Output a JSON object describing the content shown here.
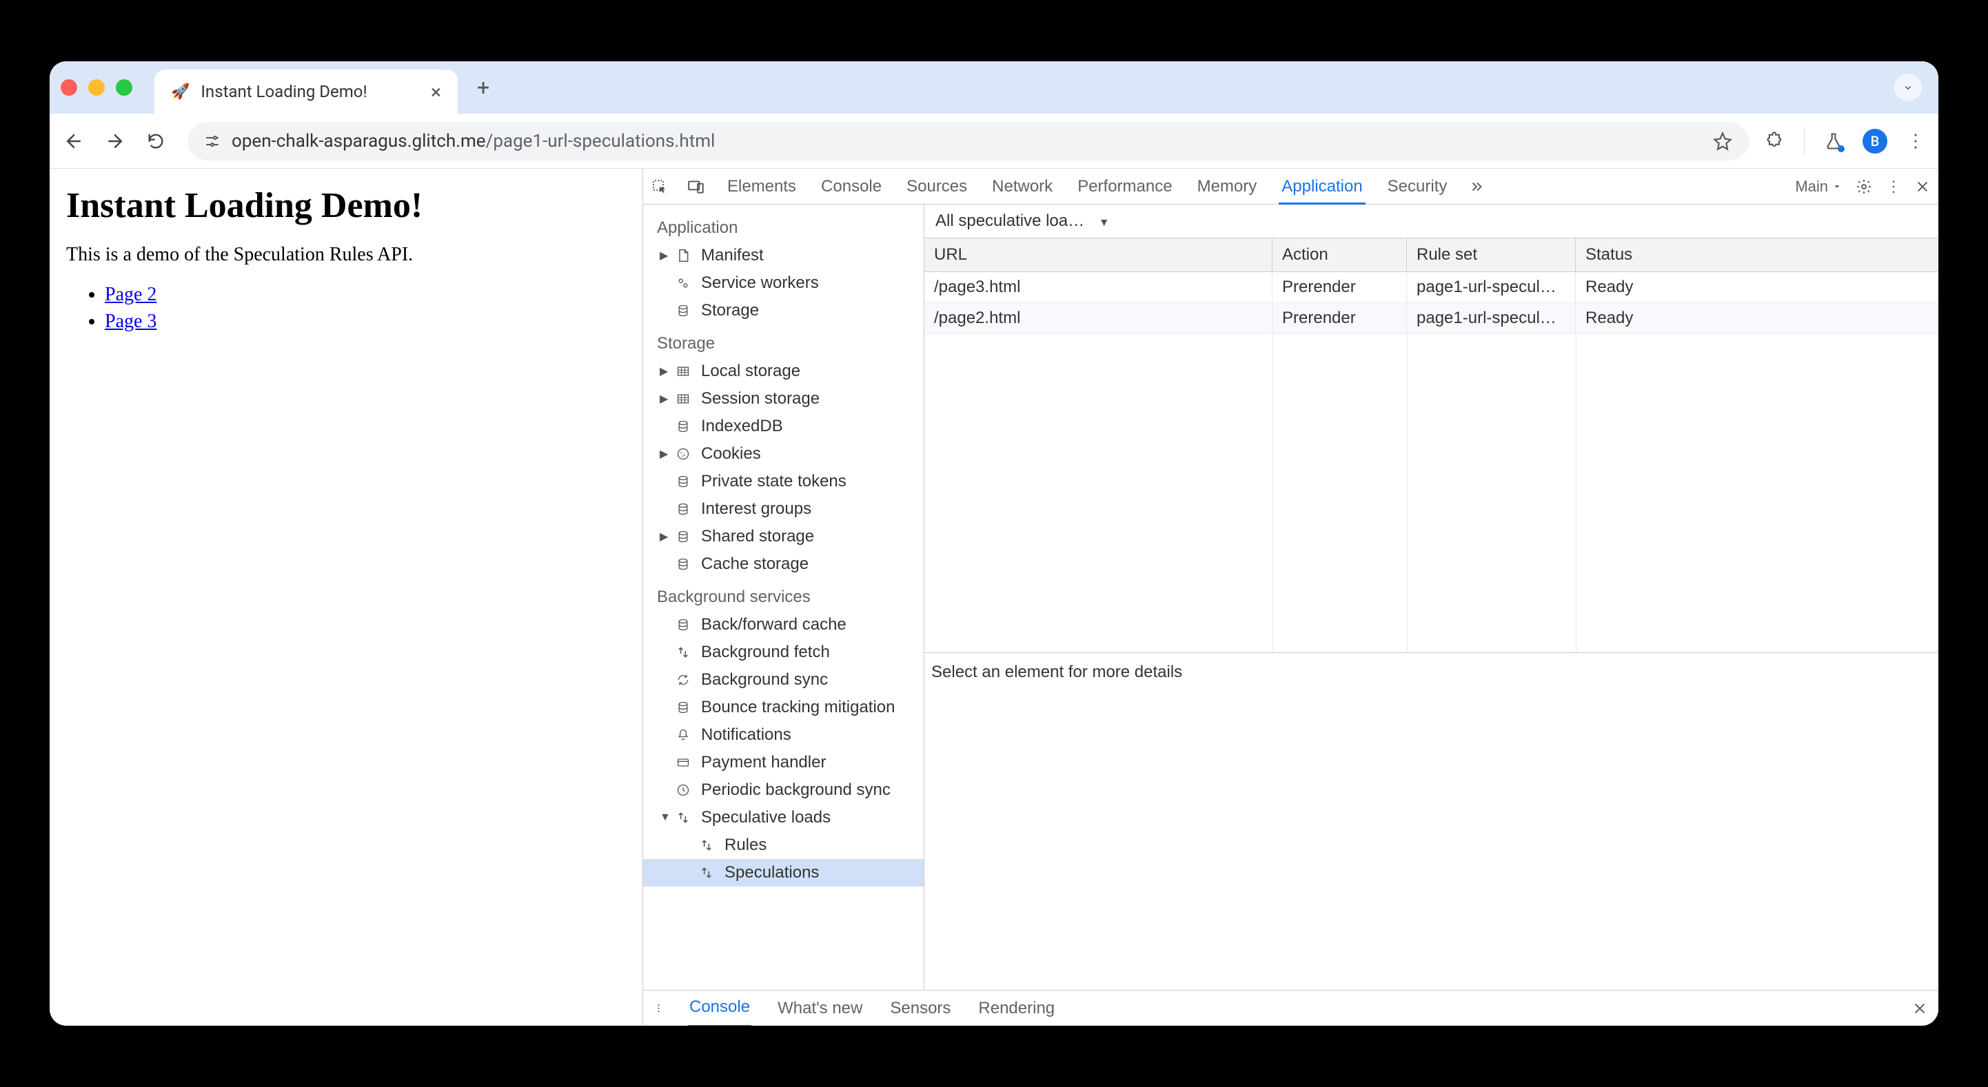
{
  "browser": {
    "tab_title": "Instant Loading Demo!",
    "url_host": "open-chalk-asparagus.glitch.me",
    "url_path": "/page1-url-speculations.html",
    "avatar_letter": "B"
  },
  "page": {
    "heading": "Instant Loading Demo!",
    "intro": "This is a demo of the Speculation Rules API.",
    "links": [
      "Page 2",
      "Page 3"
    ]
  },
  "devtools": {
    "tabs": [
      "Elements",
      "Console",
      "Sources",
      "Network",
      "Performance",
      "Memory",
      "Application",
      "Security"
    ],
    "active_tab": "Application",
    "target_label": "Main",
    "sidebar": {
      "sections": [
        {
          "title": "Application",
          "items": [
            {
              "label": "Manifest",
              "icon": "file",
              "arrow": true
            },
            {
              "label": "Service workers",
              "icon": "gears"
            },
            {
              "label": "Storage",
              "icon": "db"
            }
          ]
        },
        {
          "title": "Storage",
          "items": [
            {
              "label": "Local storage",
              "icon": "grid",
              "arrow": true
            },
            {
              "label": "Session storage",
              "icon": "grid",
              "arrow": true
            },
            {
              "label": "IndexedDB",
              "icon": "db"
            },
            {
              "label": "Cookies",
              "icon": "cookie",
              "arrow": true
            },
            {
              "label": "Private state tokens",
              "icon": "db"
            },
            {
              "label": "Interest groups",
              "icon": "db"
            },
            {
              "label": "Shared storage",
              "icon": "db",
              "arrow": true
            },
            {
              "label": "Cache storage",
              "icon": "db"
            }
          ]
        },
        {
          "title": "Background services",
          "items": [
            {
              "label": "Back/forward cache",
              "icon": "db"
            },
            {
              "label": "Background fetch",
              "icon": "updown"
            },
            {
              "label": "Background sync",
              "icon": "sync"
            },
            {
              "label": "Bounce tracking mitigation",
              "icon": "db"
            },
            {
              "label": "Notifications",
              "icon": "bell"
            },
            {
              "label": "Payment handler",
              "icon": "card"
            },
            {
              "label": "Periodic background sync",
              "icon": "clock"
            },
            {
              "label": "Speculative loads",
              "icon": "updown",
              "arrow": true,
              "expanded": true,
              "children": [
                {
                  "label": "Rules",
                  "icon": "updown"
                },
                {
                  "label": "Speculations",
                  "icon": "updown",
                  "selected": true
                }
              ]
            }
          ]
        }
      ]
    },
    "filter_label": "All speculative loa…",
    "table": {
      "headers": [
        "URL",
        "Action",
        "Rule set",
        "Status"
      ],
      "rows": [
        {
          "url": "/page3.html",
          "action": "Prerender",
          "ruleset": "page1-url-specul…",
          "status": "Ready"
        },
        {
          "url": "/page2.html",
          "action": "Prerender",
          "ruleset": "page1-url-specul…",
          "status": "Ready"
        }
      ]
    },
    "detail_hint": "Select an element for more details",
    "drawer": {
      "tabs": [
        "Console",
        "What's new",
        "Sensors",
        "Rendering"
      ],
      "active": "Console"
    }
  }
}
